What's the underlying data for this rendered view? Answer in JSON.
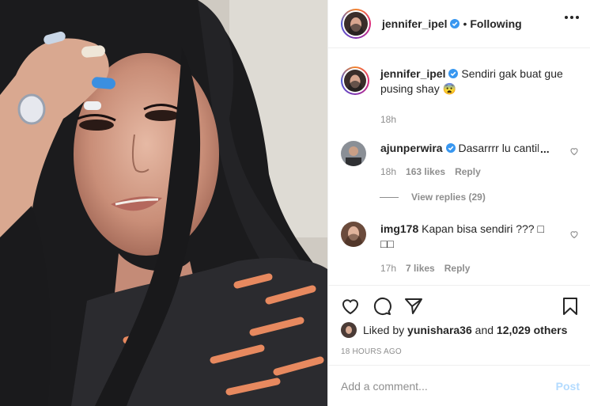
{
  "header": {
    "username": "jennifer_ipel",
    "separator": "•",
    "follow_status": "Following"
  },
  "caption": {
    "username": "jennifer_ipel",
    "text": "Sendiri gak buat gue pusing shay 😨",
    "time": "18h"
  },
  "comments": [
    {
      "username": "ajunperwira",
      "text": "Dasarrrr lu cantik",
      "ellipsis": "...",
      "time": "18h",
      "likes": "163 likes",
      "reply": "Reply",
      "view_replies": "View replies (29)"
    },
    {
      "username": "img178",
      "text": "Kapan bisa sendiri ??? □ □□",
      "time": "17h",
      "likes": "7 likes",
      "reply": "Reply"
    }
  ],
  "likes": {
    "prefix": "Liked by ",
    "user": "yunishara36",
    "middle": " and ",
    "count": "12,029 others"
  },
  "timestamp": "18 HOURS AGO",
  "add_comment": {
    "placeholder": "Add a comment...",
    "post_label": "Post"
  },
  "icons": {
    "verified": "verified-badge-icon",
    "more": "more-options-icon",
    "like": "heart-icon",
    "comment": "comment-icon",
    "share": "share-icon",
    "save": "bookmark-icon"
  },
  "colors": {
    "verified": "#3897f0",
    "text": "#262626",
    "muted": "#8e8e8e",
    "post_disabled": "#b3dbff"
  }
}
